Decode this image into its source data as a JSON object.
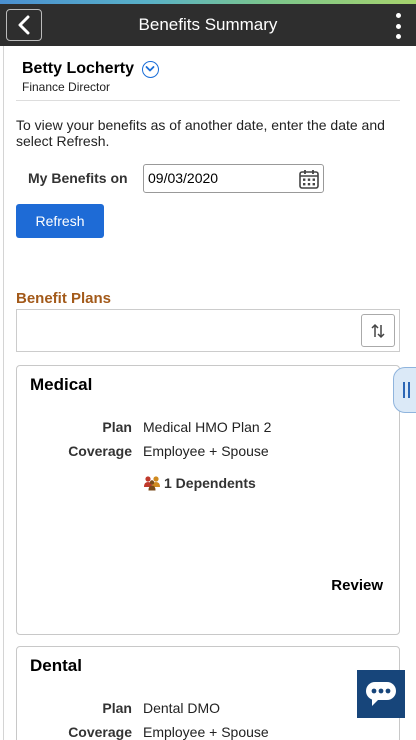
{
  "header": {
    "title": "Benefits Summary",
    "back_icon": "chevron-left-icon",
    "menu_icon": "kebab-menu-icon"
  },
  "person": {
    "name": "Betty Locherty",
    "title": "Finance Director"
  },
  "intro": "To view your benefits as of another date, enter the date and select Refresh.",
  "benefits_date": {
    "label": "My Benefits on",
    "value": "09/03/2020"
  },
  "refresh_label": "Refresh",
  "section_title": "Benefit Plans",
  "cards": [
    {
      "title": "Medical",
      "plan_label": "Plan",
      "plan_value": "Medical HMO Plan 2",
      "coverage_label": "Coverage",
      "coverage_value": "Employee + Spouse",
      "dependents": "1 Dependents",
      "review_label": "Review"
    },
    {
      "title": "Dental",
      "plan_label": "Plan",
      "plan_value": "Dental DMO",
      "coverage_label": "Coverage",
      "coverage_value": "Employee + Spouse"
    }
  ],
  "colors": {
    "header_bg": "#2e2e2e",
    "button_blue": "#1e6bd6",
    "section_title": "#a35a1a",
    "chat_bg": "#17457a"
  }
}
